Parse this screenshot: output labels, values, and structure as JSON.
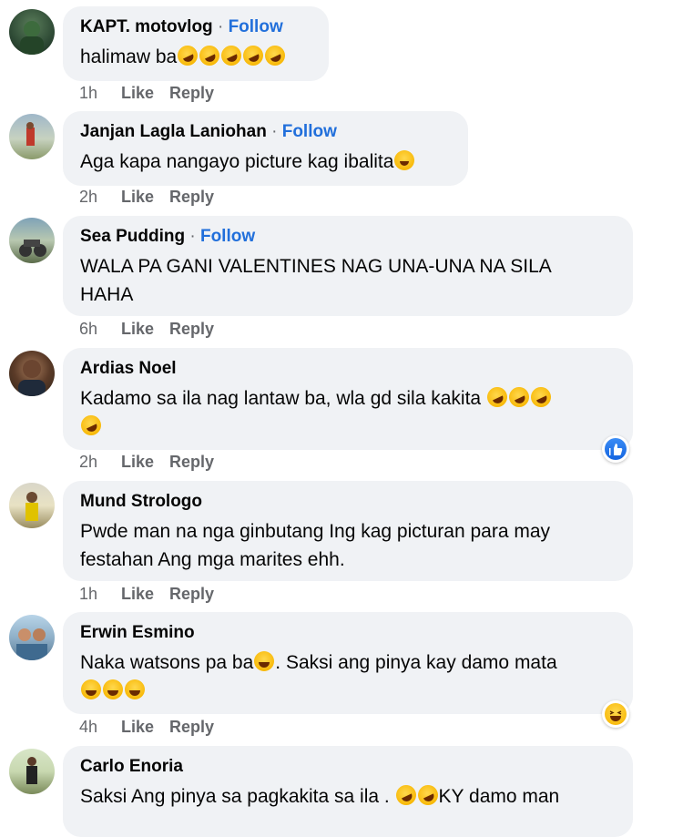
{
  "actions": {
    "like": "Like",
    "reply": "Reply",
    "follow": "Follow",
    "separator": "·"
  },
  "comments": [
    {
      "name": "KAPT. motovlog",
      "has_follow": true,
      "text": "halimaw ba",
      "emoji_suffix": [
        "rofl",
        "rofl",
        "rofl",
        "rofl",
        "rofl"
      ],
      "time": "1h"
    },
    {
      "name": "Janjan Lagla Laniohan",
      "has_follow": true,
      "text": "Aga kapa nangayo picture kag ibalita",
      "emoji_suffix": [
        "wink-tongue"
      ],
      "time": "2h"
    },
    {
      "name": "Sea Pudding",
      "has_follow": true,
      "text_line1": "WALA PA GANI VALENTINES NAG UNA-UNA NA SILA",
      "text_line2": "HAHA",
      "time": "6h"
    },
    {
      "name": "Ardias Noel",
      "has_follow": false,
      "text": "Kadamo sa ila nag lantaw ba, wla gd sila kakita",
      "emoji_suffix": [
        "rofl",
        "rofl",
        "rofl",
        "rofl"
      ],
      "time": "2h",
      "reaction": "like"
    },
    {
      "name": "Mund Strologo",
      "has_follow": false,
      "text_line1": "Pwde man na nga ginbutang Ing kag picturan para may",
      "text_line2": "festahan Ang mga marites ehh.",
      "time": "1h"
    },
    {
      "name": "Erwin Esmino",
      "has_follow": false,
      "text_part1": "Naka watsons pa ba",
      "text_part2": ". Saksi ang pinya kay damo mata",
      "emoji_suffix": [
        "joy",
        "joy",
        "joy",
        "joy"
      ],
      "time": "4h",
      "reaction": "haha"
    },
    {
      "name": "Carlo Enoria",
      "has_follow": false,
      "text_part1": "Saksi Ang pinya sa pagkakita sa ila .",
      "text_part2": "KY damo man",
      "emoji_suffix": [
        "rofl",
        "rofl"
      ]
    }
  ]
}
